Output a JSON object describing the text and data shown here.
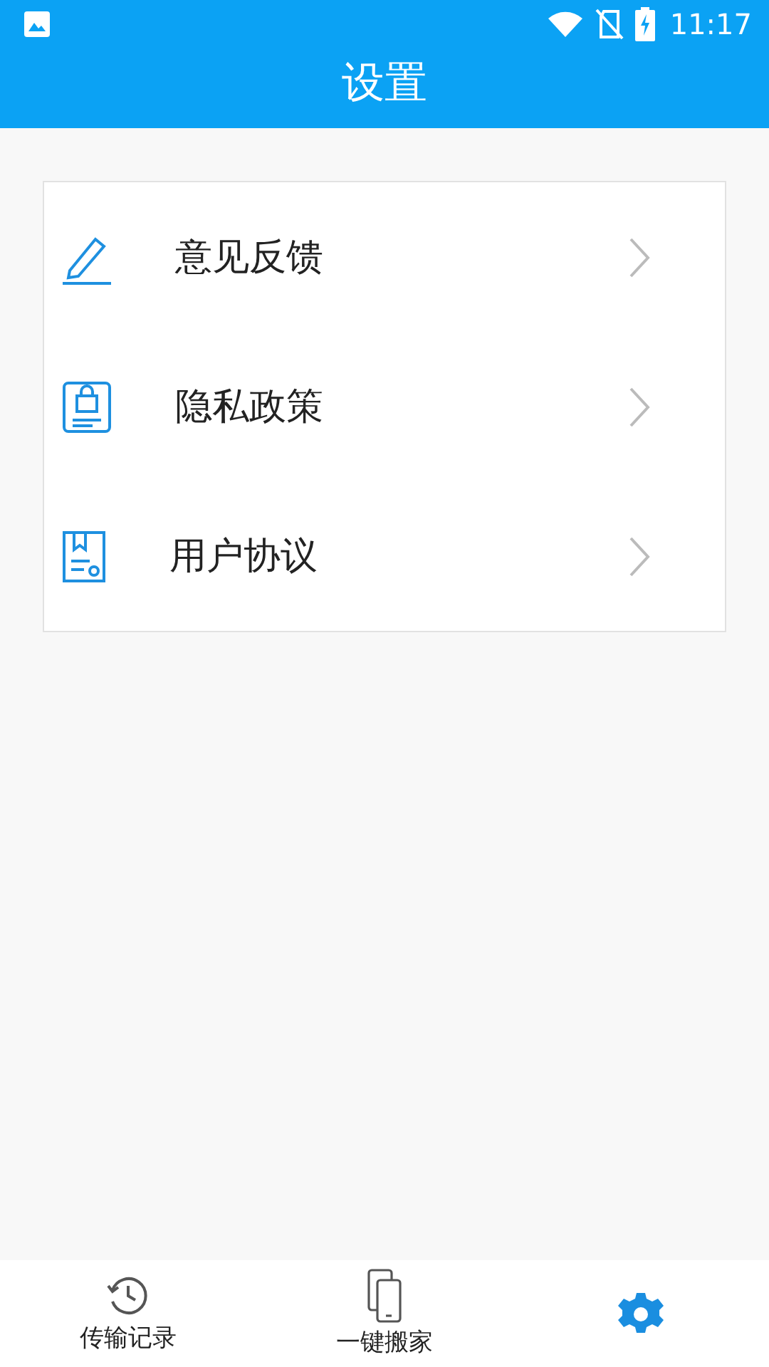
{
  "status_bar": {
    "time": "11:17"
  },
  "header": {
    "title": "设置"
  },
  "menu": [
    {
      "label": "意见反馈",
      "kind": "pen"
    },
    {
      "label": "隐私政策",
      "kind": "lock"
    },
    {
      "label": "用户协议",
      "kind": "doc"
    }
  ],
  "bottom_nav": [
    {
      "label": "传输记录",
      "kind": "history",
      "selected": false
    },
    {
      "label": "一键搬家",
      "kind": "phone",
      "selected": false
    },
    {
      "kind": "gear",
      "selected": true
    }
  ]
}
